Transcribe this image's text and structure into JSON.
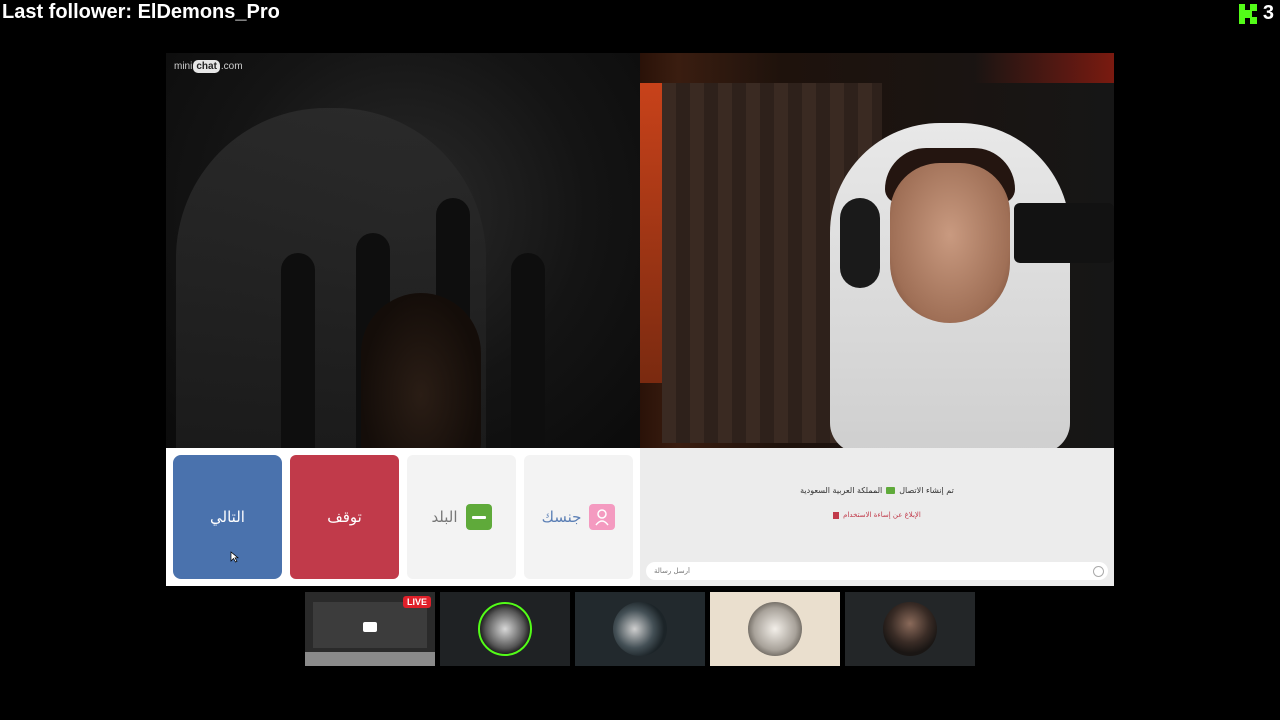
{
  "overlay": {
    "last_follower": "Last follower: ElDemons_Pro",
    "kick_count": "3",
    "kick_icon": "kick-logo-icon"
  },
  "site": {
    "logo_prefix": "mini",
    "logo_chat": "chat",
    "logo_suffix": ".com"
  },
  "controls": {
    "next_label": "التالي",
    "stop_label": "توقف",
    "country_label": "البلد",
    "gender_label": "جنسك"
  },
  "chat": {
    "connection_text": "تم إنشاء الاتصال",
    "country_name": "المملكة العربية السعودية",
    "report_text": "الإبلاغ عن إساءة الاستخدام",
    "input_placeholder": "أرسل رسالة"
  },
  "thumbnails": {
    "live_label": "LIVE"
  },
  "colors": {
    "next": "#4a72ad",
    "stop": "#c13a4a",
    "kick_green": "#53fc18",
    "live_red": "#e0202a"
  }
}
